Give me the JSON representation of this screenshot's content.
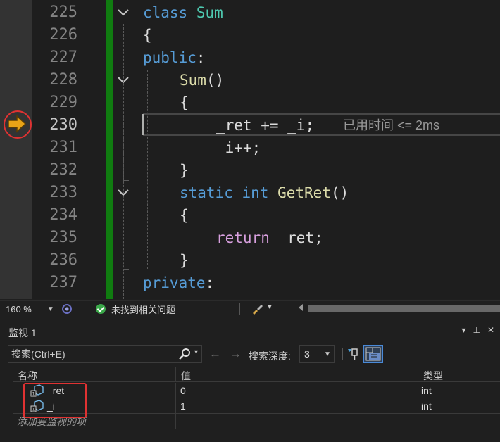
{
  "editor": {
    "line_numbers": [
      "225",
      "226",
      "227",
      "228",
      "229",
      "230",
      "231",
      "232",
      "233",
      "234",
      "235",
      "236",
      "237"
    ],
    "current_line": "230",
    "code": {
      "l225": [
        "class",
        "Sum"
      ],
      "l226": "{",
      "l227": [
        "public",
        ":"
      ],
      "l228": [
        "Sum",
        "()"
      ],
      "l229": "{",
      "l230": [
        "_ret",
        " += ",
        "_i",
        ";"
      ],
      "l231": [
        "_i",
        "++;"
      ],
      "l232": "}",
      "l233": [
        "static",
        "int",
        "GetRet",
        "()"
      ],
      "l234": "{",
      "l235": [
        "return",
        "_ret",
        ";"
      ],
      "l236": "}",
      "l237": [
        "private",
        ":"
      ]
    },
    "perf_tip": "已用时间 <= 2ms"
  },
  "status_bar": {
    "zoom": "160 %",
    "issues": "未找到相关问题"
  },
  "watch": {
    "title": "监视 1",
    "search_placeholder": "搜索(Ctrl+E)",
    "depth_label": "搜索深度:",
    "depth_value": "3",
    "columns": {
      "name": "名称",
      "value": "值",
      "type": "类型"
    },
    "rows": [
      {
        "name": "_ret",
        "value": "0",
        "type": "int"
      },
      {
        "name": "_i",
        "value": "1",
        "type": "int"
      }
    ],
    "add_watch_hint": "添加要监视的项"
  },
  "colors": {
    "keyword": "#569cd6",
    "type": "#4ec9b0",
    "function": "#dcdcaa",
    "control": "#d8a0df",
    "change_bar": "#107c10",
    "annotation": "#e03232",
    "exec_arrow": "#e8a317"
  },
  "icons": [
    "execution-arrow-icon",
    "fold-icon",
    "check-icon",
    "pin-icon",
    "search-icon",
    "watch-variable-icon",
    "hex-icon",
    "brush-icon"
  ]
}
